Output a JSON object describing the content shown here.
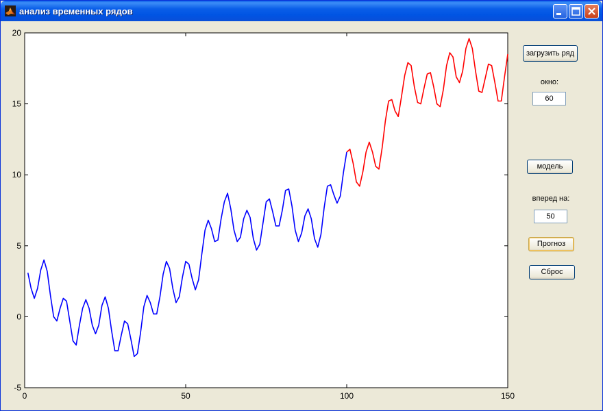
{
  "window": {
    "title": "анализ временных рядов",
    "controls": [
      "minimize-icon",
      "maximize-icon",
      "close-icon"
    ]
  },
  "panel": {
    "load_label": "загрузить ряд",
    "window_label": "окно:",
    "window_value": "60",
    "model_label": "модель",
    "ahead_label": "вперед на:",
    "ahead_value": "50",
    "forecast_label": "Прогноз",
    "reset_label": "Сброс"
  },
  "chart_data": {
    "type": "line",
    "xlim": [
      0,
      150
    ],
    "ylim": [
      -5,
      20
    ],
    "xticks": [
      0,
      50,
      100,
      150
    ],
    "yticks": [
      -5,
      0,
      5,
      10,
      15,
      20
    ],
    "grid": false,
    "series": [
      {
        "color": "#0000ff",
        "x": [
          1,
          2,
          3,
          4,
          5,
          6,
          7,
          8,
          9,
          10,
          11,
          12,
          13,
          14,
          15,
          16,
          17,
          18,
          19,
          20,
          21,
          22,
          23,
          24,
          25,
          26,
          27,
          28,
          29,
          30,
          31,
          32,
          33,
          34,
          35,
          36,
          37,
          38,
          39,
          40,
          41,
          42,
          43,
          44,
          45,
          46,
          47,
          48,
          49,
          50,
          51,
          52,
          53,
          54,
          55,
          56,
          57,
          58,
          59,
          60,
          61,
          62,
          63,
          64,
          65,
          66,
          67,
          68,
          69,
          70,
          71,
          72,
          73,
          74,
          75,
          76,
          77,
          78,
          79,
          80,
          81,
          82,
          83,
          84,
          85,
          86,
          87,
          88,
          89,
          90,
          91,
          92,
          93,
          94,
          95,
          96,
          97,
          98,
          99,
          100
        ],
        "y": [
          3.1,
          2.0,
          1.3,
          2.0,
          3.3,
          4.0,
          3.2,
          1.5,
          0.0,
          -0.3,
          0.6,
          1.3,
          1.1,
          -0.3,
          -1.7,
          -2.0,
          -0.6,
          0.6,
          1.2,
          0.6,
          -0.6,
          -1.2,
          -0.6,
          0.8,
          1.4,
          0.6,
          -1.0,
          -2.4,
          -2.4,
          -1.3,
          -0.3,
          -0.5,
          -1.6,
          -2.8,
          -2.6,
          -1.1,
          0.7,
          1.5,
          1.0,
          0.2,
          0.2,
          1.4,
          3.0,
          3.9,
          3.4,
          2.0,
          1.0,
          1.4,
          2.8,
          3.9,
          3.7,
          2.7,
          1.9,
          2.6,
          4.4,
          6.1,
          6.8,
          6.2,
          5.3,
          5.4,
          6.9,
          8.1,
          8.7,
          7.6,
          6.1,
          5.3,
          5.6,
          6.9,
          7.5,
          7.0,
          5.5,
          4.7,
          5.1,
          6.6,
          8.1,
          8.3,
          7.4,
          6.4,
          6.4,
          7.5,
          8.9,
          9.0,
          7.8,
          6.1,
          5.3,
          5.9,
          7.1,
          7.6,
          6.9,
          5.5,
          4.9,
          5.8,
          7.7,
          9.2,
          9.3,
          8.6,
          8.0,
          8.5,
          10.2,
          11.6
        ]
      },
      {
        "color": "#ff0000",
        "x": [
          100,
          101,
          102,
          103,
          104,
          105,
          106,
          107,
          108,
          109,
          110,
          111,
          112,
          113,
          114,
          115,
          116,
          117,
          118,
          119,
          120,
          121,
          122,
          123,
          124,
          125,
          126,
          127,
          128,
          129,
          130,
          131,
          132,
          133,
          134,
          135,
          136,
          137,
          138,
          139,
          140,
          141,
          142,
          143,
          144,
          145,
          146,
          147,
          148,
          149,
          150
        ],
        "y": [
          11.6,
          11.8,
          10.8,
          9.5,
          9.2,
          10.2,
          11.6,
          12.3,
          11.6,
          10.6,
          10.4,
          11.9,
          13.8,
          15.2,
          15.3,
          14.5,
          14.1,
          15.5,
          17.0,
          17.9,
          17.7,
          16.2,
          15.1,
          15.0,
          16.1,
          17.1,
          17.2,
          16.2,
          15.0,
          14.8,
          16.0,
          17.7,
          18.6,
          18.3,
          16.9,
          16.5,
          17.3,
          18.9,
          19.6,
          18.9,
          17.3,
          15.9,
          15.8,
          16.8,
          17.8,
          17.7,
          16.5,
          15.2,
          15.2,
          16.9,
          18.5
        ]
      }
    ]
  }
}
